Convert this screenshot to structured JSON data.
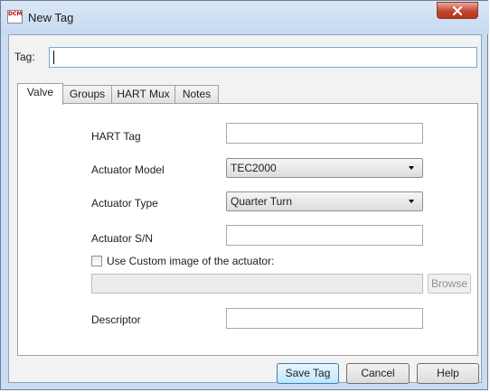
{
  "window": {
    "title": "New Tag",
    "app_icon_text": "DCM"
  },
  "tag": {
    "label": "Tag:",
    "value": ""
  },
  "tabs": [
    {
      "label": "Valve",
      "active": true
    },
    {
      "label": "Groups",
      "active": false
    },
    {
      "label": "HART Mux",
      "active": false
    },
    {
      "label": "Notes",
      "active": false
    }
  ],
  "valve": {
    "hart_tag": {
      "label": "HART Tag",
      "value": ""
    },
    "actuator_model": {
      "label": "Actuator Model",
      "selected": "TEC2000"
    },
    "actuator_type": {
      "label": "Actuator Type",
      "selected": "Quarter Turn"
    },
    "actuator_sn": {
      "label": "Actuator S/N",
      "value": ""
    },
    "custom_image": {
      "label": "Use Custom image of the actuator:",
      "checked": false,
      "path": ""
    },
    "browse_label": "Browse",
    "descriptor": {
      "label": "Descriptor",
      "value": ""
    }
  },
  "buttons": {
    "save": "Save Tag",
    "cancel": "Cancel",
    "help": "Help"
  },
  "colors": {
    "title_bar": "#c6d9f0",
    "close_button": "#c3452f",
    "default_button": "#bee6fd"
  }
}
